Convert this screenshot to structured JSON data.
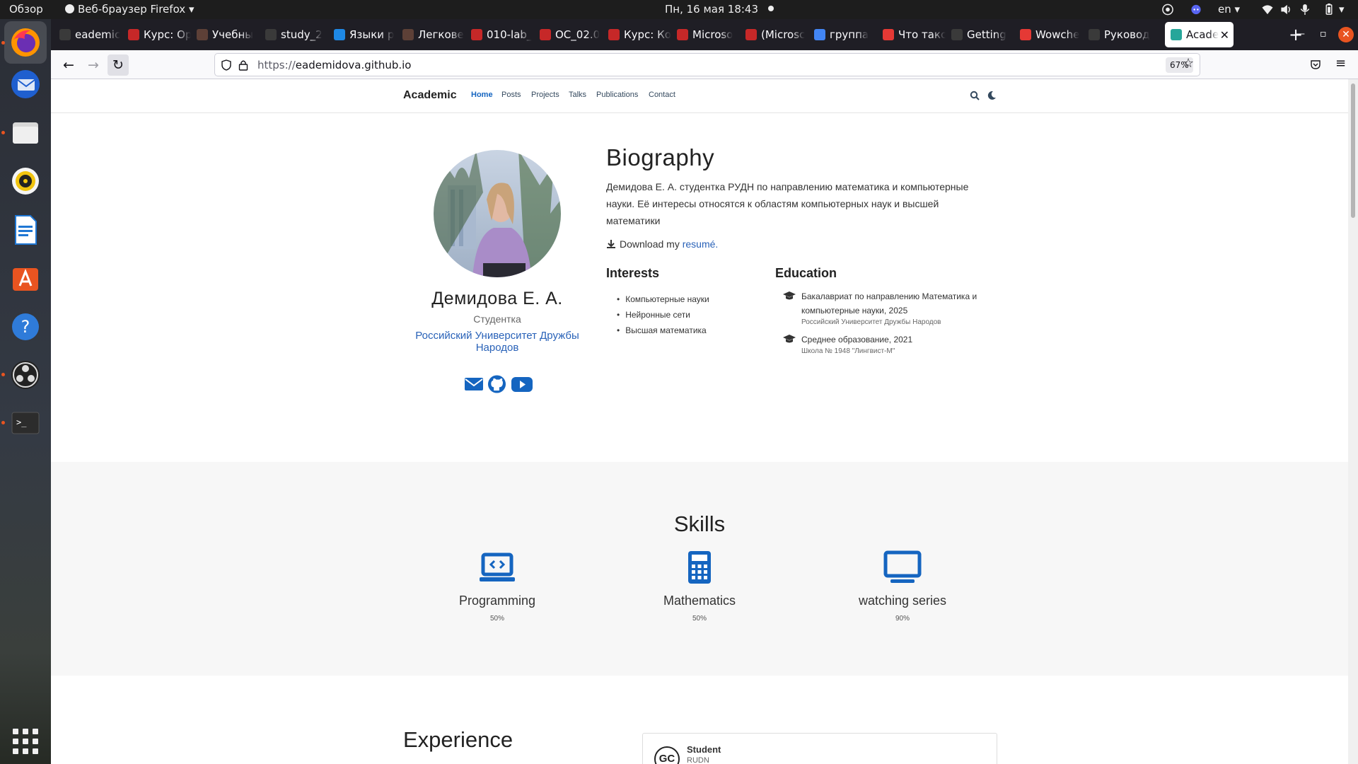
{
  "topbar": {
    "activities": "Обзор",
    "app_menu": "Веб-браузер Firefox",
    "datetime": "Пн, 16 мая  18:43",
    "lang": "en"
  },
  "tabs": [
    {
      "label": "eademic",
      "favicon_color": "#3a3a3a"
    },
    {
      "label": "Курс: Ор",
      "favicon_color": "#c62828"
    },
    {
      "label": "Учебны",
      "favicon_color": "#5d4037"
    },
    {
      "label": "study_2",
      "favicon_color": "#3a3a3a"
    },
    {
      "label": "Языки р",
      "favicon_color": "#1e88e5"
    },
    {
      "label": "Легкове",
      "favicon_color": "#5d4037"
    },
    {
      "label": "010-lab_",
      "favicon_color": "#c62828"
    },
    {
      "label": "ОС_02.0",
      "favicon_color": "#c62828"
    },
    {
      "label": "Курс: Ко",
      "favicon_color": "#c62828"
    },
    {
      "label": "Microsо",
      "favicon_color": "#c62828"
    },
    {
      "label": "(Microsc",
      "favicon_color": "#c62828"
    },
    {
      "label": "группа",
      "favicon_color": "#4285f4"
    },
    {
      "label": "Что такс",
      "favicon_color": "#e53935"
    },
    {
      "label": "Getting",
      "favicon_color": "#3a3a3a"
    },
    {
      "label": "Wowche",
      "favicon_color": "#e53935"
    },
    {
      "label": "Руковод",
      "favicon_color": "#3a3a3a"
    },
    {
      "label": "Acade",
      "favicon_color": "#26a69a",
      "selected": true
    }
  ],
  "browser": {
    "url_scheme": "https://",
    "url_host": "eademidova.github.io",
    "zoom": "67%"
  },
  "site": {
    "brand": "Academic",
    "nav": [
      "Home",
      "Posts",
      "Projects",
      "Talks",
      "Publications",
      "Contact"
    ],
    "accent": "#1565c0"
  },
  "profile": {
    "name": "Демидова Е. А.",
    "role": "Студентка",
    "org": "Российский Университет Дружбы Народов"
  },
  "bio": {
    "title": "Biography",
    "text": "Демидова Е. А. студентка РУДН по направлению математика и компьютерные науки. Её интересы относятся к областям компьютерных наук и высшей математики",
    "download_prefix": "Download my",
    "download_link": "resumé."
  },
  "interests": {
    "title": "Interests",
    "items": [
      "Компьютерные науки",
      "Нейронные сети",
      "Высшая математика"
    ]
  },
  "education": {
    "title": "Education",
    "items": [
      {
        "course": "Бакалавриат по направлению Математика и компьютерные науки, 2025",
        "institution": "Российский Университет Дружбы Народов"
      },
      {
        "course": "Среднее образование, 2021",
        "institution": "Школа № 1948 \"Лингвист-М\""
      }
    ]
  },
  "skills": {
    "title": "Skills",
    "items": [
      {
        "name": "Programming",
        "percent": "50%",
        "icon": "laptop-code-icon"
      },
      {
        "name": "Mathematics",
        "percent": "50%",
        "icon": "calculator-icon"
      },
      {
        "name": "watching series",
        "percent": "90%",
        "icon": "monitor-icon"
      }
    ]
  },
  "experience": {
    "title": "Experience",
    "card_role": "Student",
    "card_org": "RUDN",
    "card_logo": "GC"
  }
}
